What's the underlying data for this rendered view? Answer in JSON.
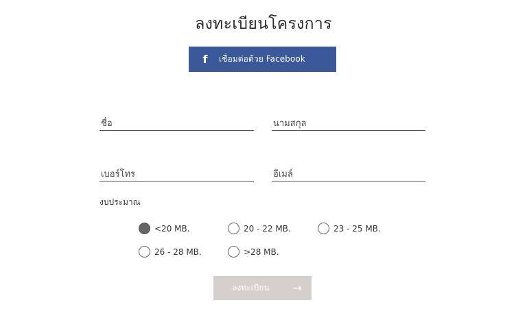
{
  "title": "ลงทะเบียนโครงการ",
  "facebook": {
    "icon": "facebook-icon",
    "label": "เชื่อมต่อด้วย Facebook",
    "color": "#3b5998"
  },
  "form": {
    "first_name": {
      "placeholder": "ชื่อ",
      "value": ""
    },
    "last_name": {
      "placeholder": "นามสกุล",
      "value": ""
    },
    "phone": {
      "placeholder": "เบอร์โทร",
      "value": ""
    },
    "email": {
      "placeholder": "อีเมล์",
      "value": ""
    }
  },
  "budget": {
    "label": "งบประมาณ",
    "options": [
      {
        "label": "<20 MB.",
        "checked": true
      },
      {
        "label": "20 - 22 MB.",
        "checked": false
      },
      {
        "label": "23 - 25 MB.",
        "checked": false
      },
      {
        "label": "26 - 28 MB.",
        "checked": false
      },
      {
        "label": ">28 MB.",
        "checked": false
      }
    ]
  },
  "submit": {
    "label": "ลงทะเบียน",
    "icon": "arrow-right-icon"
  }
}
